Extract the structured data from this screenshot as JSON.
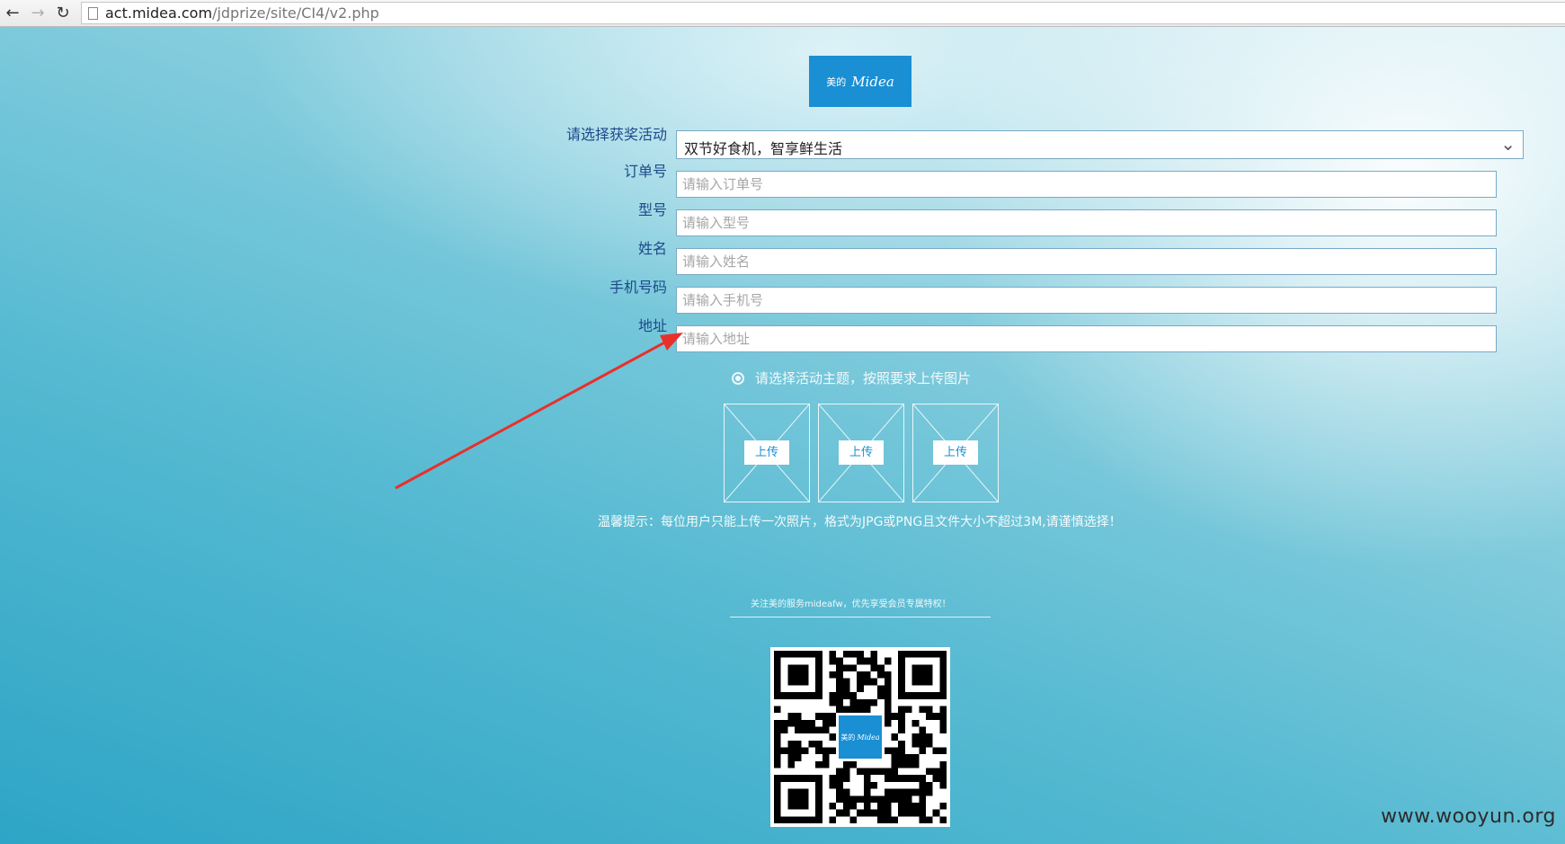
{
  "browser": {
    "url_domain": "act.midea.com",
    "url_path": "/jdprize/site/CI4/v2.php"
  },
  "logo": {
    "cn": "美的",
    "en": "Midea"
  },
  "form": {
    "activity_label": "请选择获奖活动",
    "activity_value": "双节好食机，智享鲜生活",
    "order_label": "订单号",
    "order_placeholder": "请输入订单号",
    "model_label": "型号",
    "model_placeholder": "请输入型号",
    "name_label": "姓名",
    "name_placeholder": "请输入姓名",
    "phone_label": "手机号码",
    "phone_placeholder": "请输入手机号",
    "address_label": "地址",
    "address_placeholder": "请输入地址"
  },
  "upload": {
    "radio_text": "请选择活动主题，按照要求上传图片",
    "buttons": [
      "上传",
      "上传",
      "上传"
    ],
    "hint": "温馨提示：每位用户只能上传一次照片，格式为JPG或PNG且文件大小不超过3M,请谨慎选择！"
  },
  "follow": {
    "text": "关注美的服务mideafw，优先享受会员专属特权！"
  },
  "qr": {
    "center_cn": "美的",
    "center_en": "Midea"
  },
  "watermark": "www.wooyun.org",
  "colors": {
    "brand": "#1a8fd4",
    "label": "#1c4a8a",
    "arrow": "#e8302b"
  }
}
